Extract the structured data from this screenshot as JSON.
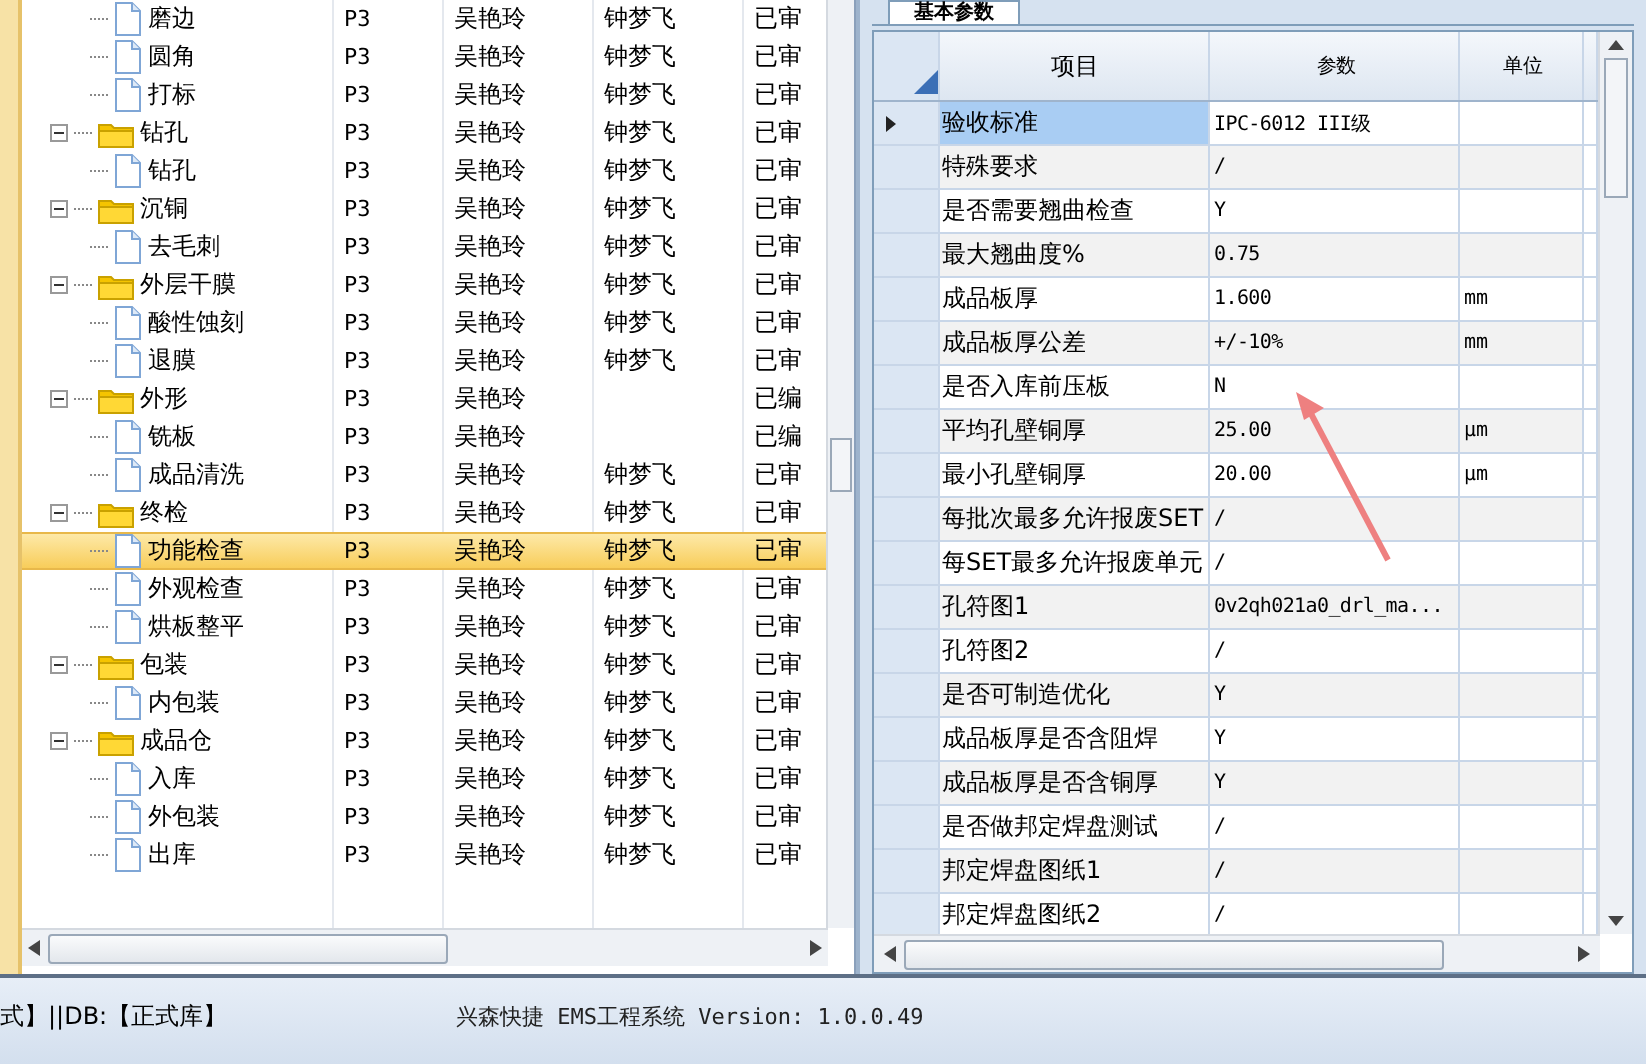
{
  "tree": {
    "nodes": [
      {
        "children": [
          {
            "label": "磨边",
            "kind": "file",
            "selected": false,
            "cells": [
              "P3",
              "吴艳玲",
              "钟梦飞",
              "已审"
            ]
          },
          {
            "label": "圆角",
            "kind": "file",
            "selected": false,
            "cells": [
              "P3",
              "吴艳玲",
              "钟梦飞",
              "已审"
            ]
          },
          {
            "label": "打标",
            "kind": "file",
            "selected": false,
            "cells": [
              "P3",
              "吴艳玲",
              "钟梦飞",
              "已审"
            ]
          }
        ]
      },
      {
        "label": "钻孔",
        "kind": "folder",
        "expanded": true,
        "selected": false,
        "cells": [
          "P3",
          "吴艳玲",
          "钟梦飞",
          "已审"
        ],
        "children": [
          {
            "label": "钻孔",
            "kind": "file",
            "selected": false,
            "cells": [
              "P3",
              "吴艳玲",
              "钟梦飞",
              "已审"
            ]
          }
        ]
      },
      {
        "label": "沉铜",
        "kind": "folder",
        "expanded": true,
        "selected": false,
        "cells": [
          "P3",
          "吴艳玲",
          "钟梦飞",
          "已审"
        ],
        "children": [
          {
            "label": "去毛刺",
            "kind": "file",
            "selected": false,
            "cells": [
              "P3",
              "吴艳玲",
              "钟梦飞",
              "已审"
            ]
          }
        ]
      },
      {
        "label": "外层干膜",
        "kind": "folder",
        "expanded": true,
        "selected": false,
        "cells": [
          "P3",
          "吴艳玲",
          "钟梦飞",
          "已审"
        ],
        "children": [
          {
            "label": "酸性蚀刻",
            "kind": "file",
            "selected": false,
            "cells": [
              "P3",
              "吴艳玲",
              "钟梦飞",
              "已审"
            ]
          },
          {
            "label": "退膜",
            "kind": "file",
            "selected": false,
            "cells": [
              "P3",
              "吴艳玲",
              "钟梦飞",
              "已审"
            ]
          }
        ]
      },
      {
        "label": "外形",
        "kind": "folder",
        "expanded": true,
        "selected": false,
        "cells": [
          "P3",
          "吴艳玲",
          null,
          "已编"
        ],
        "children": [
          {
            "label": "铣板",
            "kind": "file",
            "selected": false,
            "cells": [
              "P3",
              "吴艳玲",
              null,
              "已编"
            ]
          },
          {
            "label": "成品清洗",
            "kind": "file",
            "selected": false,
            "cells": [
              "P3",
              "吴艳玲",
              "钟梦飞",
              "已审"
            ]
          }
        ]
      },
      {
        "label": "终检",
        "kind": "folder",
        "expanded": true,
        "selected": false,
        "cells": [
          "P3",
          "吴艳玲",
          "钟梦飞",
          "已审"
        ],
        "children": [
          {
            "label": "功能检查",
            "kind": "file",
            "selected": true,
            "cells": [
              "P3",
              "吴艳玲",
              "钟梦飞",
              "已审"
            ]
          },
          {
            "label": "外观检查",
            "kind": "file",
            "selected": false,
            "cells": [
              "P3",
              "吴艳玲",
              "钟梦飞",
              "已审"
            ]
          },
          {
            "label": "烘板整平",
            "kind": "file",
            "selected": false,
            "cells": [
              "P3",
              "吴艳玲",
              "钟梦飞",
              "已审"
            ]
          }
        ]
      },
      {
        "label": "包装",
        "kind": "folder",
        "expanded": true,
        "selected": false,
        "cells": [
          "P3",
          "吴艳玲",
          "钟梦飞",
          "已审"
        ],
        "children": [
          {
            "label": "内包装",
            "kind": "file",
            "selected": false,
            "cells": [
              "P3",
              "吴艳玲",
              "钟梦飞",
              "已审"
            ]
          }
        ]
      },
      {
        "label": "成品仓",
        "kind": "folder",
        "expanded": true,
        "selected": false,
        "cells": [
          "P3",
          "吴艳玲",
          "钟梦飞",
          "已审"
        ],
        "children": [
          {
            "label": "入库",
            "kind": "file",
            "selected": false,
            "cells": [
              "P3",
              "吴艳玲",
              "钟梦飞",
              "已审"
            ]
          },
          {
            "label": "外包装",
            "kind": "file",
            "selected": false,
            "cells": [
              "P3",
              "吴艳玲",
              "钟梦飞",
              "已审"
            ]
          },
          {
            "label": "出库",
            "kind": "file",
            "selected": false,
            "cells": [
              "P3",
              "吴艳玲",
              "钟梦飞",
              "已审"
            ]
          }
        ]
      }
    ]
  },
  "params": {
    "tab": {
      "label": "基本参数",
      "selected": true
    },
    "columns": [
      "项目",
      "参数",
      "单位"
    ],
    "rows": [
      {
        "item": "验收标准",
        "value": "IPC-6012 III级",
        "unit": "",
        "selected": true
      },
      {
        "item": "特殊要求",
        "value": "/",
        "unit": "",
        "selected": false
      },
      {
        "item": "是否需要翘曲检查",
        "value": "Y",
        "unit": "",
        "selected": false
      },
      {
        "item": "最大翘曲度%",
        "value": "0.75",
        "unit": "",
        "selected": false
      },
      {
        "item": "成品板厚",
        "value": "1.600",
        "unit": "mm",
        "selected": false
      },
      {
        "item": "成品板厚公差",
        "value": "+/-10%",
        "unit": "mm",
        "selected": false
      },
      {
        "item": "是否入库前压板",
        "value": "N",
        "unit": "",
        "selected": false
      },
      {
        "item": "平均孔壁铜厚",
        "value": "25.00",
        "unit": "µm",
        "selected": false
      },
      {
        "item": "最小孔壁铜厚",
        "value": "20.00",
        "unit": "µm",
        "selected": false
      },
      {
        "item": "每批次最多允许报废SET",
        "value": "/",
        "unit": "",
        "selected": false
      },
      {
        "item": "每SET最多允许报废单元",
        "value": "/",
        "unit": "",
        "selected": false
      },
      {
        "item": "孔符图1",
        "value": "0v2qh021a0_drl_ma...",
        "unit": "",
        "selected": false
      },
      {
        "item": "孔符图2",
        "value": "/",
        "unit": "",
        "selected": false
      },
      {
        "item": "是否可制造优化",
        "value": "Y",
        "unit": "",
        "selected": false
      },
      {
        "item": "成品板厚是否含阻焊",
        "value": "Y",
        "unit": "",
        "selected": false
      },
      {
        "item": "成品板厚是否含铜厚",
        "value": "Y",
        "unit": "",
        "selected": false
      },
      {
        "item": "是否做邦定焊盘测试",
        "value": "/",
        "unit": "",
        "selected": false
      },
      {
        "item": "邦定焊盘图纸1",
        "value": "/",
        "unit": "",
        "selected": false
      },
      {
        "item": "邦定焊盘图纸2",
        "value": "/",
        "unit": "",
        "selected": false
      }
    ]
  },
  "status_bar": {
    "left": "式】||DB:【正式库】",
    "right": "兴森快捷 EMS工程系统 Version: 1.0.0.49"
  }
}
